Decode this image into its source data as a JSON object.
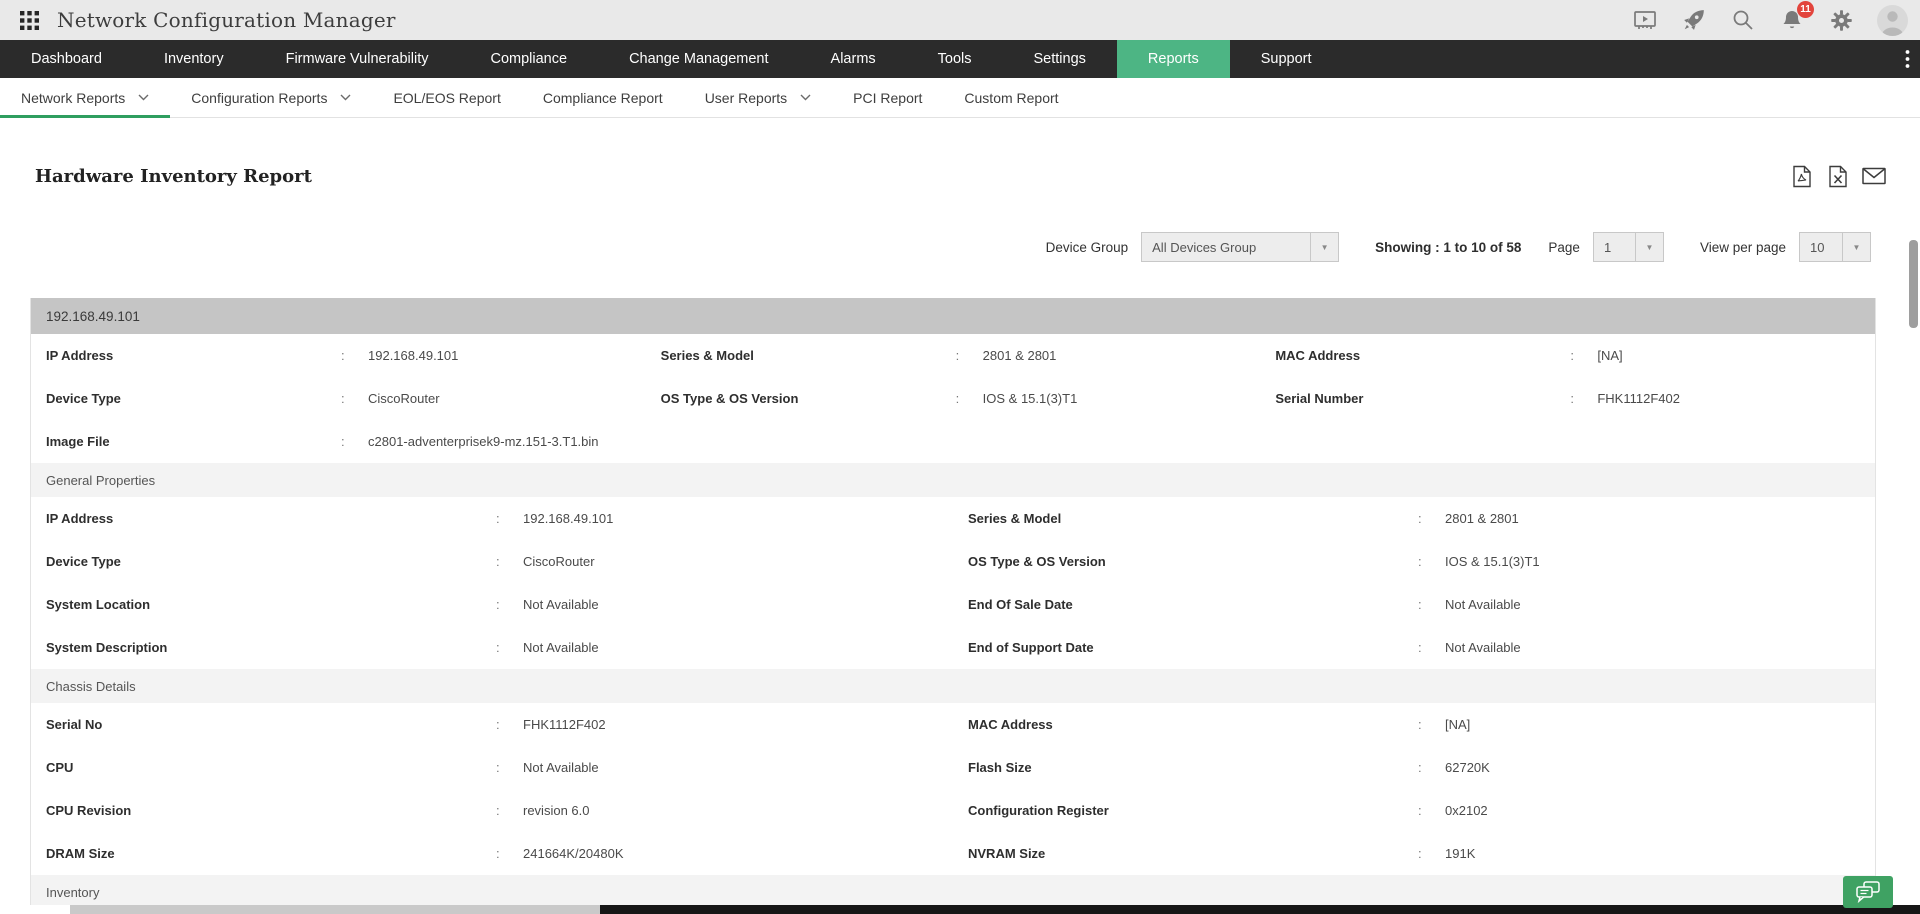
{
  "app": {
    "title": "Network Configuration Manager",
    "notification_count": "11"
  },
  "colors": {
    "accent_green": "#4db584",
    "subnav_underline_green": "#2f9e5f",
    "nav_bg": "#2b2b2b",
    "badge_red": "#e2443c",
    "device_band_gray": "#c5c5c5",
    "section_band_gray": "#f3f3f3"
  },
  "header_icons": [
    "grid-menu-icon",
    "demo-player-icon",
    "rocket-icon",
    "search-icon",
    "notifications-bell-icon",
    "settings-gear-icon",
    "user-avatar"
  ],
  "nav": {
    "items": [
      {
        "label": "Dashboard"
      },
      {
        "label": "Inventory"
      },
      {
        "label": "Firmware Vulnerability"
      },
      {
        "label": "Compliance"
      },
      {
        "label": "Change Management"
      },
      {
        "label": "Alarms"
      },
      {
        "label": "Tools"
      },
      {
        "label": "Settings"
      },
      {
        "label": "Reports",
        "active": true
      },
      {
        "label": "Support"
      }
    ]
  },
  "subnav": {
    "items": [
      {
        "label": "Network Reports",
        "dropdown": true,
        "active": true
      },
      {
        "label": "Configuration Reports",
        "dropdown": true
      },
      {
        "label": "EOL/EOS Report"
      },
      {
        "label": "Compliance Report"
      },
      {
        "label": "User Reports",
        "dropdown": true
      },
      {
        "label": "PCI Report"
      },
      {
        "label": "Custom Report"
      }
    ]
  },
  "report": {
    "title": "Hardware Inventory Report",
    "export_icons": [
      "pdf-export-icon",
      "excel-export-icon",
      "email-report-icon"
    ]
  },
  "controls": {
    "device_group_label": "Device Group",
    "device_group_value": "All Devices Group",
    "showing_text": "Showing : 1 to 10 of 58",
    "page_label": "Page",
    "page_value": "1",
    "view_per_page_label": "View per page",
    "view_per_page_value": "10"
  },
  "report_table": {
    "device_header": "192.168.49.101",
    "summary": {
      "rows": [
        {
          "cells": [
            {
              "label": "IP Address",
              "value": "192.168.49.101"
            },
            {
              "label": "Series & Model",
              "value": "2801 & 2801"
            },
            {
              "label": "MAC Address",
              "value": "[NA]"
            }
          ]
        },
        {
          "cells": [
            {
              "label": "Device Type",
              "value": "CiscoRouter"
            },
            {
              "label": "OS Type & OS Version",
              "value": "IOS & 15.1(3)T1"
            },
            {
              "label": "Serial Number",
              "value": "FHK1112F402"
            }
          ]
        },
        {
          "cells": [
            {
              "label": "Image File",
              "value": "c2801-adventerprisek9-mz.151-3.T1.bin"
            }
          ]
        }
      ]
    },
    "sections": [
      {
        "title": "General Properties",
        "rows": [
          {
            "cells": [
              {
                "label": "IP Address",
                "value": "192.168.49.101"
              },
              {
                "label": "Series & Model",
                "value": "2801 & 2801"
              }
            ]
          },
          {
            "cells": [
              {
                "label": "Device Type",
                "value": "CiscoRouter"
              },
              {
                "label": "OS Type & OS Version",
                "value": "IOS & 15.1(3)T1"
              }
            ]
          },
          {
            "cells": [
              {
                "label": "System Location",
                "value": "Not Available"
              },
              {
                "label": "End Of Sale Date",
                "value": "Not Available"
              }
            ]
          },
          {
            "cells": [
              {
                "label": "System Description",
                "value": "Not Available"
              },
              {
                "label": "End of Support Date",
                "value": "Not Available"
              }
            ]
          }
        ]
      },
      {
        "title": "Chassis Details",
        "rows": [
          {
            "cells": [
              {
                "label": "Serial No",
                "value": "FHK1112F402"
              },
              {
                "label": "MAC Address",
                "value": "[NA]"
              }
            ]
          },
          {
            "cells": [
              {
                "label": "CPU",
                "value": "Not Available"
              },
              {
                "label": "Flash Size",
                "value": "62720K"
              }
            ]
          },
          {
            "cells": [
              {
                "label": "CPU Revision",
                "value": "revision 6.0"
              },
              {
                "label": "Configuration Register",
                "value": "0x2102"
              }
            ]
          },
          {
            "cells": [
              {
                "label": "DRAM Size",
                "value": "241664K/20480K"
              },
              {
                "label": "NVRAM Size",
                "value": "191K"
              }
            ]
          }
        ]
      },
      {
        "title": "Inventory",
        "rows": []
      }
    ]
  }
}
